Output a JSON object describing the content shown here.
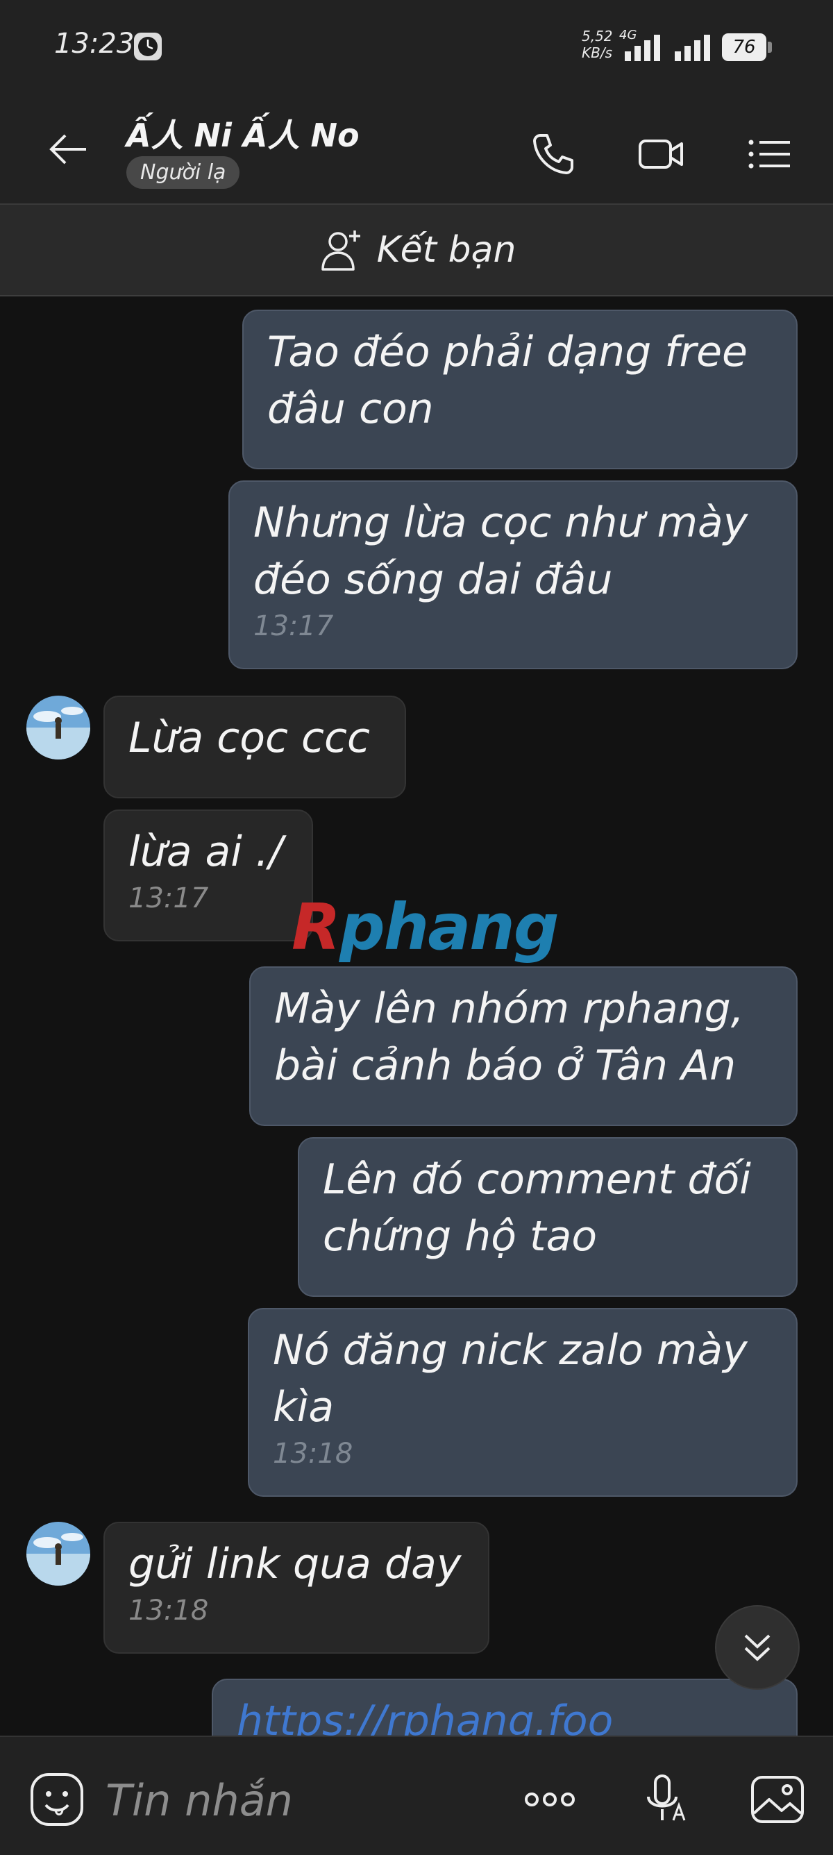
{
  "status": {
    "time": "13:23",
    "net_speed_value": "5,52",
    "net_speed_unit": "KB/s",
    "network": "4G",
    "battery": "76"
  },
  "header": {
    "contact_name": "Ấ人 Ni Ấ人 No",
    "badge": "Người lạ"
  },
  "add_friend": {
    "label": "Kết bạn"
  },
  "messages": [
    {
      "dir": "out",
      "text": "Tao đéo phải dạng free đâu con"
    },
    {
      "dir": "out",
      "text": "Nhưng lừa cọc như mày đéo sống dai đâu",
      "time": "13:17"
    },
    {
      "dir": "in",
      "text": "Lừa cọc ccc"
    },
    {
      "dir": "in",
      "text": "lừa ai ./",
      "time": "13:17"
    },
    {
      "dir": "out",
      "text": "Mày lên nhóm rphang, bài cảnh báo ở Tân An"
    },
    {
      "dir": "out",
      "text": "Lên đó comment đối chứng hộ tao"
    },
    {
      "dir": "out",
      "text": "Nó đăng nick zalo mày kìa",
      "time": "13:18"
    },
    {
      "dir": "in",
      "text": "gửi link qua day",
      "time": "13:18"
    },
    {
      "dir": "out",
      "text": "https://rphang.foo"
    }
  ],
  "watermark": {
    "first": "R",
    "rest": "phang"
  },
  "input": {
    "placeholder": "Tin nhắn"
  },
  "colors": {
    "outgoing_bubble": "#3b4553",
    "incoming_bubble": "#272727",
    "background": "#121212",
    "link": "#3f78d0"
  }
}
